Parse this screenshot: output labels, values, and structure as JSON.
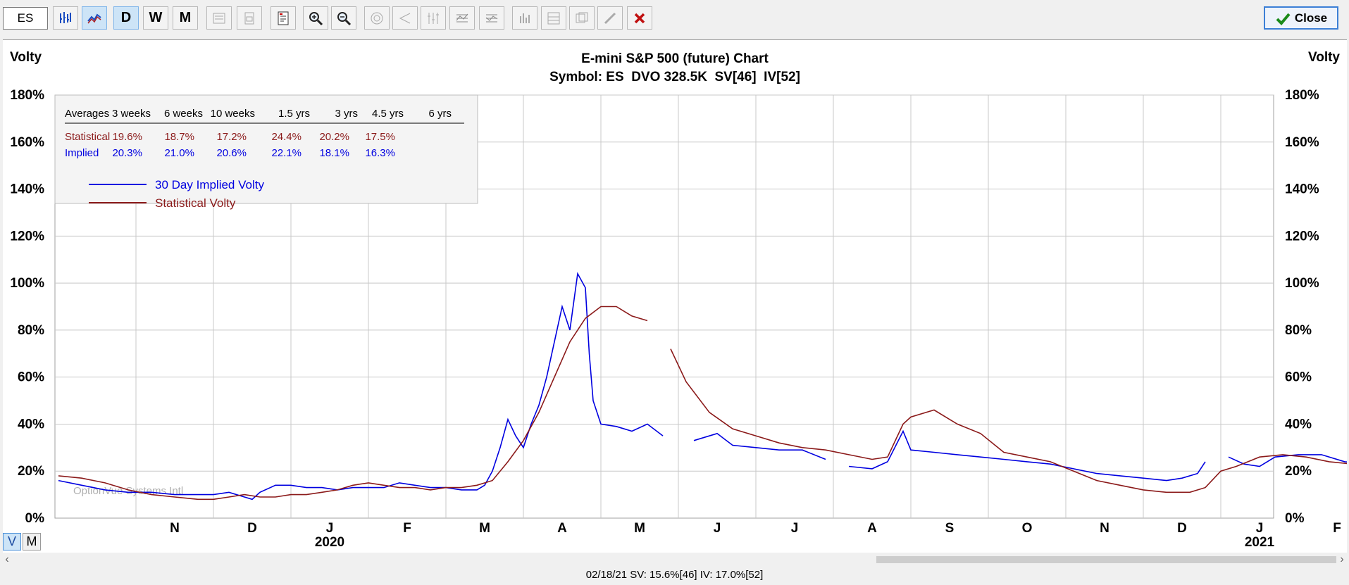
{
  "toolbar": {
    "symbol_value": "ES",
    "buttons": [
      {
        "name": "bar-chart-icon",
        "left": 75
      },
      {
        "name": "line-chart-icon",
        "left": 117
      }
    ],
    "daily_label": "D",
    "weekly_label": "W",
    "monthly_label": "M",
    "close_label": "Close"
  },
  "chart": {
    "title": "E-mini S&P 500 (future) Chart",
    "subtitle": "Symbol: ES  DVO 328.5K  SV[46]  IV[52]",
    "left_axis_label": "Volty",
    "right_axis_label": "Volty",
    "watermark": "OptionVue Systems Intl",
    "colors": {
      "implied": "#0000e0",
      "statistical": "#8b1a1a",
      "grid": "#c8c8c8"
    }
  },
  "averages_table": {
    "header_label": "Averages",
    "periods": [
      "3 weeks",
      "6 weeks",
      "10 weeks",
      "1.5 yrs",
      "3 yrs",
      "4.5 yrs",
      "6 yrs"
    ],
    "rows": [
      {
        "label": "Statistical",
        "values": [
          "19.6%",
          "18.7%",
          "17.2%",
          "24.4%",
          "20.2%",
          "17.5%",
          ""
        ]
      },
      {
        "label": "Implied",
        "values": [
          "20.3%",
          "21.0%",
          "20.6%",
          "22.1%",
          "18.1%",
          "16.3%",
          ""
        ]
      }
    ]
  },
  "view_toggle": {
    "v_label": "V",
    "m_label": "M"
  },
  "status_line": "02/18/21  SV: 15.6%[46]  IV: 17.0%[52]",
  "chart_data": {
    "type": "line",
    "title": "E-mini S&P 500 (future) Chart",
    "ylabel": "Volty",
    "ylim": [
      0,
      180
    ],
    "y_ticks": [
      "0%",
      "20%",
      "40%",
      "60%",
      "80%",
      "100%",
      "120%",
      "140%",
      "160%",
      "180%"
    ],
    "x_month_labels": [
      "N",
      "D",
      "J",
      "F",
      "M",
      "A",
      "M",
      "J",
      "J",
      "A",
      "S",
      "O",
      "N",
      "D",
      "J",
      "F"
    ],
    "x_year_labels": [
      {
        "label": "2020",
        "month_index": 2
      },
      {
        "label": "2021",
        "month_index": 14
      }
    ],
    "x_start_month": "2019-10",
    "legend": [
      {
        "name": "30 Day Implied Volty",
        "color": "#0000e0"
      },
      {
        "name": "Statistical Volty",
        "color": "#8b1a1a"
      }
    ],
    "series": [
      {
        "name": "30 Day Implied Volty",
        "color": "#0000e0",
        "points": [
          [
            0.0,
            16
          ],
          [
            0.3,
            14
          ],
          [
            0.6,
            12
          ],
          [
            0.9,
            11
          ],
          [
            1.2,
            11
          ],
          [
            1.5,
            10
          ],
          [
            1.8,
            10
          ],
          [
            2.0,
            10
          ],
          [
            2.2,
            11
          ],
          [
            2.4,
            9
          ],
          [
            2.5,
            8
          ],
          [
            2.6,
            11
          ],
          [
            2.8,
            14
          ],
          [
            3.0,
            14
          ],
          [
            3.2,
            13
          ],
          [
            3.4,
            13
          ],
          [
            3.6,
            12
          ],
          [
            3.8,
            13
          ],
          [
            4.0,
            13
          ],
          [
            4.2,
            13
          ],
          [
            4.4,
            15
          ],
          [
            4.6,
            14
          ],
          [
            4.8,
            13
          ],
          [
            5.0,
            13
          ],
          [
            5.2,
            12
          ],
          [
            5.4,
            12
          ],
          [
            5.5,
            14
          ],
          [
            5.6,
            20
          ],
          [
            5.7,
            30
          ],
          [
            5.8,
            42
          ],
          [
            5.9,
            35
          ],
          [
            6.0,
            30
          ],
          [
            6.1,
            40
          ],
          [
            6.2,
            48
          ],
          [
            6.3,
            60
          ],
          [
            6.4,
            75
          ],
          [
            6.5,
            90
          ],
          [
            6.6,
            80
          ],
          [
            6.7,
            104
          ],
          [
            6.8,
            98
          ],
          [
            6.85,
            70
          ],
          [
            6.9,
            50
          ],
          [
            7.0,
            40
          ],
          [
            7.2,
            39
          ],
          [
            7.4,
            37
          ],
          [
            7.6,
            40
          ],
          [
            7.8,
            35
          ],
          [
            7.9,
            null
          ],
          [
            8.2,
            33
          ],
          [
            8.5,
            36
          ],
          [
            8.7,
            31
          ],
          [
            9.0,
            30
          ],
          [
            9.3,
            29
          ],
          [
            9.6,
            29
          ],
          [
            9.9,
            25
          ],
          [
            10.0,
            null
          ],
          [
            10.2,
            22
          ],
          [
            10.5,
            21
          ],
          [
            10.7,
            24
          ],
          [
            10.9,
            37
          ],
          [
            11.0,
            29
          ],
          [
            11.3,
            28
          ],
          [
            11.6,
            27
          ],
          [
            11.9,
            26
          ],
          [
            12.2,
            25
          ],
          [
            12.5,
            24
          ],
          [
            12.8,
            23
          ],
          [
            13.1,
            21
          ],
          [
            13.4,
            19
          ],
          [
            13.7,
            18
          ],
          [
            14.0,
            17
          ],
          [
            14.3,
            16
          ],
          [
            14.5,
            17
          ],
          [
            14.7,
            19
          ],
          [
            14.8,
            24
          ],
          [
            14.9,
            null
          ],
          [
            15.1,
            26
          ],
          [
            15.3,
            23
          ],
          [
            15.5,
            22
          ],
          [
            15.7,
            26
          ],
          [
            16.0,
            27
          ],
          [
            16.3,
            27
          ],
          [
            16.6,
            24
          ],
          [
            16.9,
            23
          ],
          [
            17.2,
            25
          ],
          [
            17.4,
            28
          ],
          [
            17.6,
            32
          ],
          [
            17.8,
            30
          ],
          [
            18.0,
            25
          ],
          [
            18.3,
            20
          ],
          [
            18.6,
            19
          ],
          [
            18.9,
            18
          ],
          [
            19.1,
            17
          ],
          [
            19.2,
            null
          ],
          [
            19.6,
            16
          ],
          [
            19.8,
            15
          ],
          [
            20.0,
            16
          ],
          [
            20.3,
            20
          ],
          [
            20.5,
            19
          ],
          [
            20.8,
            21
          ],
          [
            21.0,
            20
          ],
          [
            21.3,
            20
          ],
          [
            21.6,
            21
          ],
          [
            21.9,
            20
          ],
          [
            22.2,
            21
          ],
          [
            22.5,
            21
          ],
          [
            22.8,
            19
          ],
          [
            23.0,
            22
          ],
          [
            23.2,
            25
          ],
          [
            23.4,
            21
          ],
          [
            23.6,
            19
          ],
          [
            23.8,
            18
          ],
          [
            24.0,
            18
          ],
          [
            24.2,
            17
          ],
          [
            24.4,
            17
          ]
        ]
      },
      {
        "name": "Statistical Volty",
        "color": "#8b1a1a",
        "points": [
          [
            0.0,
            18
          ],
          [
            0.3,
            17
          ],
          [
            0.6,
            15
          ],
          [
            0.9,
            12
          ],
          [
            1.2,
            10
          ],
          [
            1.5,
            9
          ],
          [
            1.8,
            8
          ],
          [
            2.0,
            8
          ],
          [
            2.2,
            9
          ],
          [
            2.4,
            10
          ],
          [
            2.6,
            9
          ],
          [
            2.8,
            9
          ],
          [
            3.0,
            10
          ],
          [
            3.2,
            10
          ],
          [
            3.4,
            11
          ],
          [
            3.6,
            12
          ],
          [
            3.8,
            14
          ],
          [
            4.0,
            15
          ],
          [
            4.2,
            14
          ],
          [
            4.4,
            13
          ],
          [
            4.6,
            13
          ],
          [
            4.8,
            12
          ],
          [
            5.0,
            13
          ],
          [
            5.2,
            13
          ],
          [
            5.4,
            14
          ],
          [
            5.6,
            16
          ],
          [
            5.8,
            24
          ],
          [
            6.0,
            33
          ],
          [
            6.2,
            45
          ],
          [
            6.4,
            60
          ],
          [
            6.6,
            75
          ],
          [
            6.8,
            85
          ],
          [
            7.0,
            90
          ],
          [
            7.2,
            90
          ],
          [
            7.4,
            86
          ],
          [
            7.6,
            84
          ],
          [
            7.7,
            null
          ],
          [
            7.9,
            72
          ],
          [
            8.1,
            58
          ],
          [
            8.4,
            45
          ],
          [
            8.7,
            38
          ],
          [
            9.0,
            35
          ],
          [
            9.3,
            32
          ],
          [
            9.6,
            30
          ],
          [
            9.9,
            29
          ],
          [
            10.2,
            27
          ],
          [
            10.5,
            25
          ],
          [
            10.7,
            26
          ],
          [
            10.9,
            40
          ],
          [
            11.0,
            43
          ],
          [
            11.3,
            46
          ],
          [
            11.6,
            40
          ],
          [
            11.9,
            36
          ],
          [
            12.2,
            28
          ],
          [
            12.5,
            26
          ],
          [
            12.8,
            24
          ],
          [
            13.1,
            20
          ],
          [
            13.4,
            16
          ],
          [
            13.7,
            14
          ],
          [
            14.0,
            12
          ],
          [
            14.3,
            11
          ],
          [
            14.6,
            11
          ],
          [
            14.8,
            13
          ],
          [
            15.0,
            20
          ],
          [
            15.2,
            22
          ],
          [
            15.5,
            26
          ],
          [
            15.8,
            27
          ],
          [
            16.1,
            26
          ],
          [
            16.4,
            24
          ],
          [
            16.7,
            23
          ],
          [
            17.0,
            23
          ],
          [
            17.3,
            20
          ],
          [
            17.6,
            23
          ],
          [
            17.9,
            29
          ],
          [
            18.1,
            31
          ],
          [
            18.4,
            27
          ],
          [
            18.7,
            25
          ],
          [
            19.0,
            23
          ],
          [
            19.3,
            18
          ],
          [
            19.6,
            15
          ],
          [
            19.9,
            14
          ],
          [
            20.2,
            14
          ],
          [
            20.5,
            13
          ],
          [
            20.8,
            14
          ],
          [
            21.1,
            15
          ],
          [
            21.4,
            16
          ],
          [
            21.7,
            19
          ],
          [
            22.0,
            17
          ],
          [
            22.3,
            17
          ],
          [
            22.6,
            18
          ],
          [
            22.9,
            22
          ],
          [
            23.1,
            24
          ],
          [
            23.4,
            21
          ],
          [
            23.7,
            18
          ],
          [
            24.0,
            16
          ],
          [
            24.2,
            16
          ]
        ]
      }
    ],
    "current_marker_month_index": 24.4
  }
}
